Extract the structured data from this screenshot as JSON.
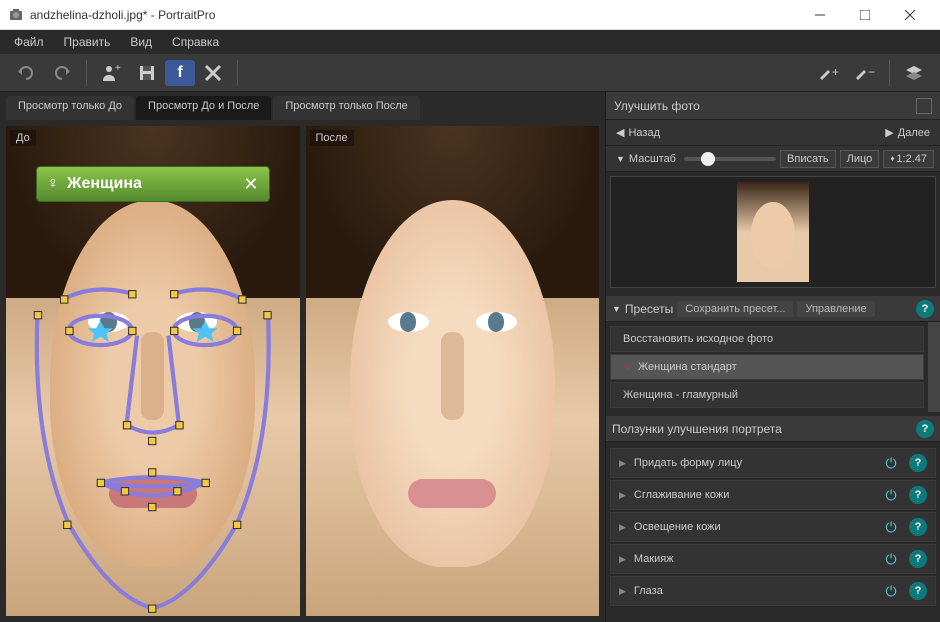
{
  "window": {
    "title": "andzhelina-dzholi.jpg* - PortraitPro"
  },
  "menubar": {
    "items": [
      "Файл",
      "Править",
      "Вид",
      "Справка"
    ]
  },
  "view_tabs": {
    "tabs": [
      {
        "label": "Просмотр только До",
        "active": false
      },
      {
        "label": "Просмотр До и После",
        "active": true
      },
      {
        "label": "Просмотр только После",
        "active": false
      }
    ]
  },
  "panels": {
    "before": "До",
    "after": "После"
  },
  "gender_tag": {
    "label": "Женщина"
  },
  "sidebar": {
    "title": "Улучшить фото",
    "nav": {
      "back": "Назад",
      "next": "Далее"
    },
    "zoom": {
      "label": "Масштаб",
      "fit": "Вписать",
      "face": "Лицо",
      "value": "1:2.47"
    },
    "presets": {
      "header": "Пресеты",
      "save": "Сохранить пресет...",
      "manage": "Управление",
      "items": [
        {
          "label": "Восстановить исходное фото",
          "icon": ""
        },
        {
          "label": "Женщина стандарт",
          "icon": "♀",
          "selected": true
        },
        {
          "label": "Женщина - гламурный",
          "icon": ""
        }
      ]
    },
    "sliders": {
      "header": "Ползунки улучшения портрета",
      "groups": [
        "Придать форму лицу",
        "Сглаживание кожи",
        "Освещение кожи",
        "Макияж",
        "Глаза"
      ]
    }
  }
}
